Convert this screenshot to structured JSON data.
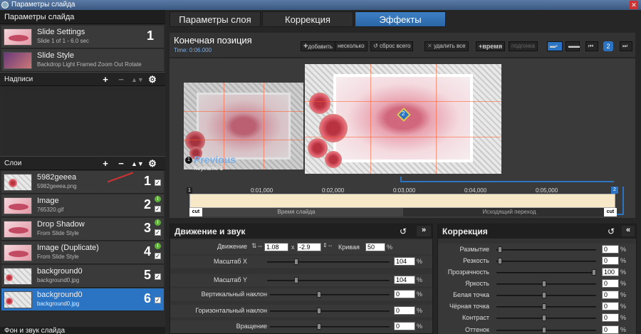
{
  "window": {
    "title": "Параметры слайда"
  },
  "left": {
    "header": "Параметры слайда",
    "slides": [
      {
        "title": "Slide Settings",
        "subtitle": "Slide 1 of 1 - 6.0 sec",
        "num": "1"
      },
      {
        "title": "Slide Style",
        "subtitle": "Backdrop Light Framed Zoom Out Rotate"
      }
    ],
    "captions_header": "Надписи",
    "layers_header": "Слои",
    "layers": [
      {
        "title": "5982geeea",
        "subtitle": "5982geeea.png",
        "num": "1"
      },
      {
        "title": "Image",
        "subtitle": "765320.gif",
        "num": "2"
      },
      {
        "title": "Drop Shadow",
        "subtitle": "From Slide Style",
        "num": "3"
      },
      {
        "title": "Image (Duplicate)",
        "subtitle": "From Slide Style",
        "num": "4"
      },
      {
        "title": "background0",
        "subtitle": "background0.jpg",
        "num": "5"
      },
      {
        "title": "background0",
        "subtitle": "background0.jpg",
        "num": "6"
      }
    ],
    "bottom_header": "Фон и звук слайда"
  },
  "tabs": [
    "Параметры слоя",
    "Коррекция",
    "Эффекты"
  ],
  "keyframe": {
    "title": "Конечная позиция",
    "time": "Time: 0:06.000",
    "buttons": {
      "add": "добавить",
      "several": "несколько",
      "reset": "сброс всего",
      "delete": "удалить все",
      "time": "время",
      "fit": "подгонка"
    },
    "badge": "2"
  },
  "preview": {
    "prev_title": "Previous",
    "prev_sub": "Keyframe 1",
    "marker1": "1",
    "marker2": "2"
  },
  "timeline": {
    "ticks": [
      "0:01,000",
      "0:02,000",
      "0:03,000",
      "0:04,000",
      "0:05,000"
    ],
    "slide_time": "Время слайда",
    "outgoing": "Исходящий переход",
    "cut": "cut"
  },
  "motion": {
    "title": "Движение и звук",
    "move_label": "Движение",
    "move_x": "1.08",
    "x_label": "x",
    "move_y": "-2.9",
    "curve_label": "Кривая",
    "curve_val": "50",
    "rows": [
      {
        "label": "Масштаб X",
        "value": "104"
      },
      {
        "label": "Масштаб Y",
        "value": "104"
      },
      {
        "label": "Вертикальный наклон",
        "value": "0"
      },
      {
        "label": "Горизонтальный наклон",
        "value": "0"
      },
      {
        "label": "Вращение",
        "value": "0"
      }
    ],
    "pct": "%"
  },
  "correction": {
    "title": "Коррекция",
    "rows": [
      {
        "label": "Размытие",
        "value": "0"
      },
      {
        "label": "Резкость",
        "value": "0"
      },
      {
        "label": "Прозрачность",
        "value": "100"
      },
      {
        "label": "Яркость",
        "value": "0"
      },
      {
        "label": "Белая точка",
        "value": "0"
      },
      {
        "label": "Чёрная точка",
        "value": "0"
      },
      {
        "label": "Контраст",
        "value": "0"
      },
      {
        "label": "Оттенок",
        "value": "0"
      }
    ]
  },
  "colors": {
    "accent": "#2b74c4",
    "tab_active": "#3d7fc4",
    "timeline": "#f7e8c8"
  }
}
